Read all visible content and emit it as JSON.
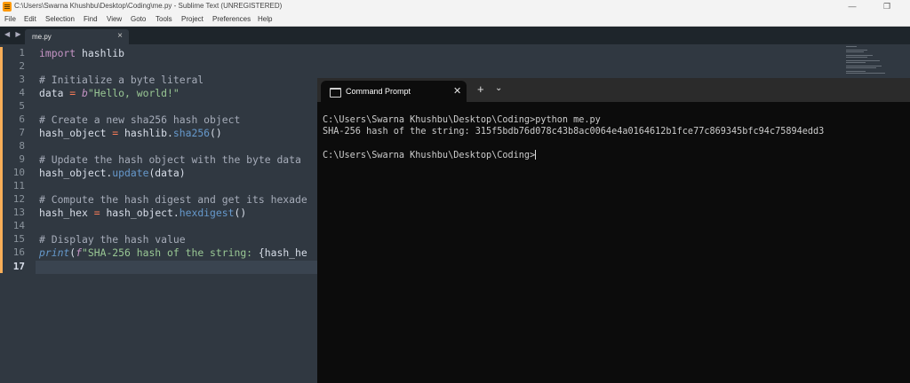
{
  "window": {
    "title": "C:\\Users\\Swarna Khushbu\\Desktop\\Coding\\me.py - Sublime Text (UNREGISTERED)",
    "minimize": "—",
    "restore": "❐"
  },
  "menu": [
    "File",
    "Edit",
    "Selection",
    "Find",
    "View",
    "Goto",
    "Tools",
    "Project",
    "Preferences",
    "Help"
  ],
  "tabs": {
    "nav": "◀ ▶",
    "active_tab": "me.py",
    "close": "×"
  },
  "editor": {
    "line_numbers": [
      "1",
      "2",
      "3",
      "4",
      "5",
      "6",
      "7",
      "8",
      "9",
      "10",
      "11",
      "12",
      "13",
      "14",
      "15",
      "16",
      "17"
    ],
    "active_line": "17",
    "lines": {
      "l1_kw": "import",
      "l1_rest": " hashlib",
      "l3": "# Initialize a byte literal",
      "l4_var": "data ",
      "l4_op": "=",
      "l4_prefix": " b",
      "l4_str": "\"Hello, world!\"",
      "l6": "# Create a new sha256 hash object",
      "l7_var": "hash_object ",
      "l7_op": "=",
      "l7_mod": " hashlib.",
      "l7_fn": "sha256",
      "l7_end": "()",
      "l9": "# Update the hash object with the byte data",
      "l10_var": "hash_object.",
      "l10_fn": "update",
      "l10_end": "(data)",
      "l12": "# Compute the hash digest and get its hexade",
      "l13_var": "hash_hex ",
      "l13_op": "=",
      "l13_mid": " hash_object.",
      "l13_fn": "hexdigest",
      "l13_end": "()",
      "l15": "# Display the hash value",
      "l16_fn": "print",
      "l16_paren": "(",
      "l16_f": "f",
      "l16_str": "\"SHA-256 hash of the string: ",
      "l16_end": "{hash_he"
    }
  },
  "terminal": {
    "tab_title": "Command Prompt",
    "tab_close": "✕",
    "new_tab": "+",
    "dropdown": "⌄",
    "lines": [
      "C:\\Users\\Swarna Khushbu\\Desktop\\Coding>python me.py",
      "SHA-256 hash of the string: 315f5bdb76d078c43b8ac0064e4a0164612b1fce77c869345bfc94c75894edd3",
      "",
      "C:\\Users\\Swarna Khushbu\\Desktop\\Coding>"
    ]
  },
  "colors": {
    "editor_bg": "#303841",
    "comment": "#a6acb9",
    "keyword": "#c594c5",
    "string": "#99c794",
    "function": "#6699cc",
    "operator": "#f97b58",
    "terminal_bg": "#0c0c0c"
  },
  "icons": [
    "sublime-text-icon",
    "command-prompt-icon",
    "minimize-icon",
    "restore-icon",
    "close-icon",
    "plus-icon",
    "chevron-down-icon"
  ]
}
